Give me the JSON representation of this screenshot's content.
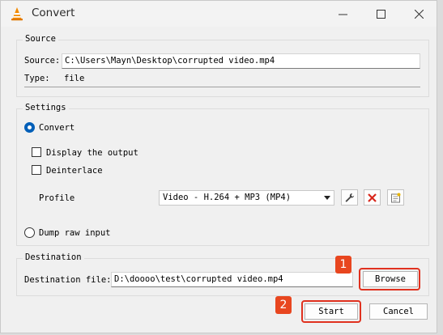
{
  "window": {
    "title": "Convert"
  },
  "source": {
    "group_title": "Source",
    "source_label": "Source:",
    "source_value": "C:\\Users\\Mayn\\Desktop\\corrupted video.mp4",
    "type_label": "Type:",
    "type_value": "file"
  },
  "settings": {
    "group_title": "Settings",
    "convert_label": "Convert",
    "display_output_label": "Display the output",
    "deinterlace_label": "Deinterlace",
    "profile_label": "Profile",
    "profile_value": "Video - H.264 + MP3 (MP4)",
    "dump_raw_label": "Dump raw input"
  },
  "destination": {
    "group_title": "Destination",
    "file_label": "Destination file:",
    "file_value": "D:\\doooo\\test\\corrupted video.mp4",
    "browse_label": "Browse"
  },
  "buttons": {
    "start_label": "Start",
    "cancel_label": "Cancel"
  },
  "annotations": {
    "marker_1": "1",
    "marker_2": "2"
  },
  "colors": {
    "highlight": "#e0311f",
    "marker_bg": "#e8461f",
    "radio_accent": "#005fb8"
  }
}
